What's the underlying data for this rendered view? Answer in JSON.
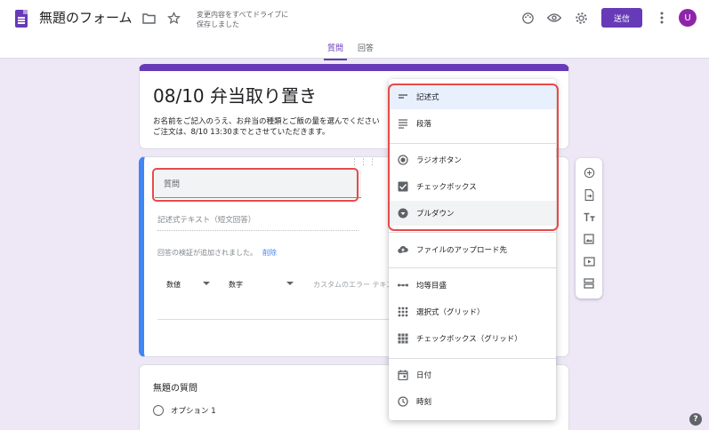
{
  "header": {
    "title": "無題のフォーム",
    "save_status": "変更内容をすべてドライブに\n保存しました",
    "send_label": "送信",
    "avatar_initial": "U",
    "icons": [
      "folder-icon",
      "star-icon",
      "palette-icon",
      "eye-icon",
      "gear-icon",
      "more-vert-icon"
    ]
  },
  "tabs": [
    {
      "label": "質問",
      "active": true
    },
    {
      "label": "回答",
      "active": false
    }
  ],
  "form": {
    "title": "08/10 弁当取り置き",
    "description": "お名前をご記入のうえ、お弁当の種類とご飯の量を選んでください\nご注文は、8/10 13:30までとさせていただきます。"
  },
  "question_card": {
    "drag_handle": "⋮⋮⋮",
    "question_placeholder": "質問",
    "answer_hint": "記述式テキスト（短文回答）",
    "validation_text": "回答の検証が追加されました。",
    "validation_delete": "削除",
    "validation_type": "数値",
    "validation_condition": "数字",
    "error_placeholder": "カスタムのエラー テキス"
  },
  "next_card": {
    "title": "無題の質問",
    "option_label": "オプション 1"
  },
  "menu": {
    "items": [
      {
        "label": "記述式",
        "icon": "short-text-icon",
        "selected": true
      },
      {
        "label": "段落",
        "icon": "paragraph-icon"
      },
      {
        "label": "ラジオボタン",
        "icon": "radio-button-icon"
      },
      {
        "label": "チェックボックス",
        "icon": "checkbox-icon"
      },
      {
        "label": "プルダウン",
        "icon": "dropdown-icon",
        "hovered": true
      },
      {
        "label": "ファイルのアップロード先",
        "icon": "cloud-upload-icon"
      },
      {
        "label": "均等目盛",
        "icon": "linear-scale-icon"
      },
      {
        "label": "選択式（グリッド）",
        "icon": "grid-icon"
      },
      {
        "label": "チェックボックス（グリッド）",
        "icon": "checkbox-grid-icon"
      },
      {
        "label": "日付",
        "icon": "calendar-icon"
      },
      {
        "label": "時刻",
        "icon": "clock-icon"
      }
    ]
  },
  "side_toolbar": {
    "icons": [
      "add-question-icon",
      "import-questions-icon",
      "add-title-icon",
      "add-image-icon",
      "add-video-icon",
      "add-section-icon"
    ]
  },
  "colors": {
    "accent": "#673ab7",
    "active_border": "#4285f4",
    "highlight_red": "#e84a4a",
    "background": "#ede7f6"
  }
}
